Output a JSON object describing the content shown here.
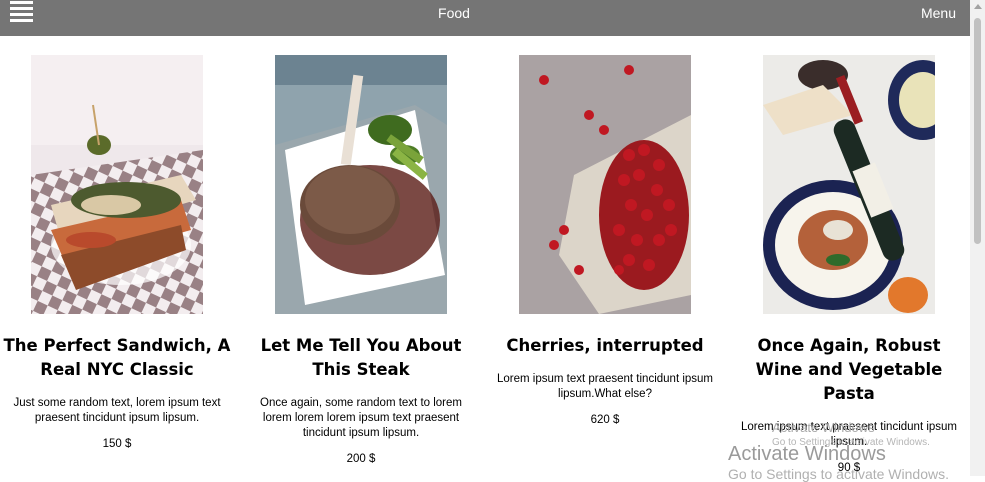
{
  "header": {
    "title": "Food",
    "menu_label": "Menu"
  },
  "cards": [
    {
      "title": "The Perfect Sandwich, A Real NYC Classic",
      "text": "Just some random text, lorem ipsum text praesent tincidunt ipsum lipsum.",
      "price": "150 $"
    },
    {
      "title": "Let Me Tell You About This Steak",
      "text": "Once again, some random text to lorem lorem lorem lorem ipsum text praesent tincidunt ipsum lipsum.",
      "price": "200 $"
    },
    {
      "title": "Cherries, interrupted",
      "text": "Lorem ipsum text praesent tincidunt ipsum lipsum.What else?",
      "price": "620 $"
    },
    {
      "title": "Once Again, Robust Wine and Vegetable Pasta",
      "text": "Lorem ipsum text praesent tincidunt ipsum lipsum.",
      "price": "90 $"
    }
  ],
  "watermark": {
    "line1": "Activate Windows",
    "line2": "Go to Settings to activate Windows."
  },
  "icons": {
    "menu": "hamburger-menu-icon"
  }
}
